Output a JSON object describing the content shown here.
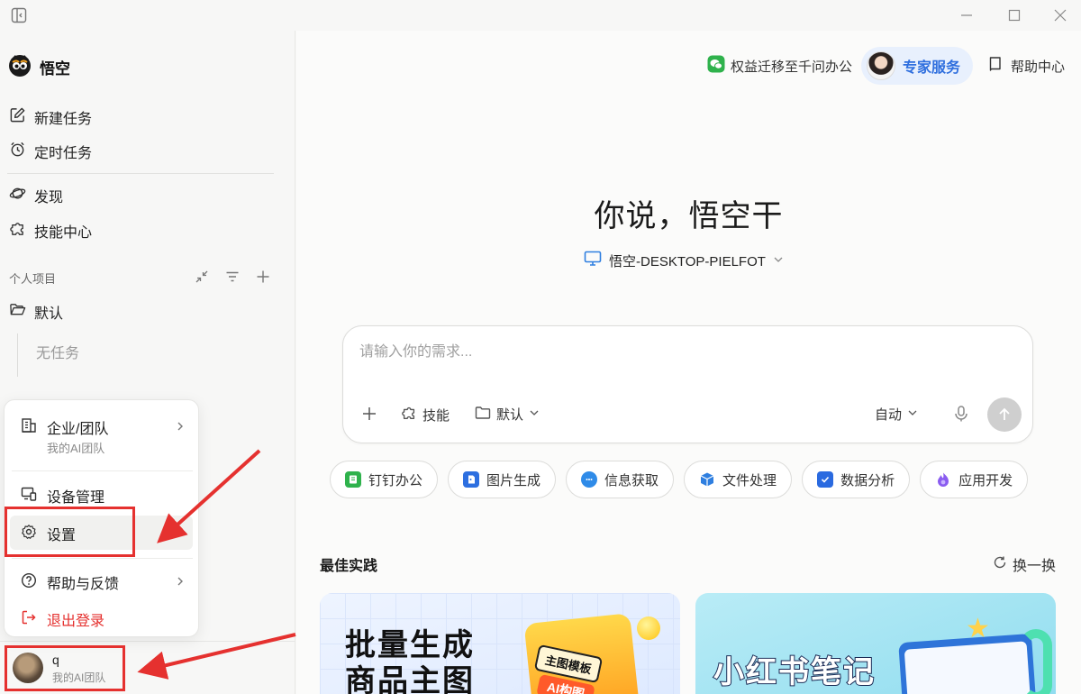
{
  "app": {
    "name": "悟空"
  },
  "sidebar": {
    "nav_top": [
      {
        "label": "新建任务",
        "icon": "edit-icon"
      },
      {
        "label": "定时任务",
        "icon": "alarm-clock-icon"
      }
    ],
    "nav_mid": [
      {
        "label": "发现",
        "icon": "planet-icon"
      },
      {
        "label": "技能中心",
        "icon": "puzzle-icon"
      }
    ],
    "projects": {
      "label": "个人项目",
      "folder": "默认",
      "empty_text": "无任务"
    }
  },
  "popup_menu": {
    "team": {
      "label": "企业/团队",
      "sub": "我的AI团队"
    },
    "device": {
      "label": "设备管理"
    },
    "settings": {
      "label": "设置"
    },
    "help": {
      "label": "帮助与反馈"
    },
    "logout": {
      "label": "退出登录"
    }
  },
  "user": {
    "name": "q",
    "team": "我的AI团队"
  },
  "header": {
    "migrate": "权益迁移至千问办公",
    "expert": "专家服务",
    "help": "帮助中心"
  },
  "hero": {
    "title": "你说，悟空干",
    "device": "悟空-DESKTOP-PIELFOT"
  },
  "input": {
    "placeholder": "请输入你的需求...",
    "skill": "技能",
    "folder": "默认",
    "mode": "自动"
  },
  "chips": [
    {
      "label": "钉钉办公",
      "icon": "dingtalk-icon",
      "color": "#2fb24c"
    },
    {
      "label": "图片生成",
      "icon": "image-doc-icon",
      "color": "#2d6fe0"
    },
    {
      "label": "信息获取",
      "icon": "chat-bubble-icon",
      "color": "#2f8be8"
    },
    {
      "label": "文件处理",
      "icon": "cube-icon",
      "color": "#2f7fe0"
    },
    {
      "label": "数据分析",
      "icon": "checkbox-icon",
      "color": "#2a6ae0"
    },
    {
      "label": "应用开发",
      "icon": "flame-icon",
      "color": "#8a5cf0"
    }
  ],
  "best_practice": {
    "title": "最佳实践",
    "refresh": "换一换",
    "cards": [
      {
        "title_line1": "批量生成",
        "title_line2": "商品主图",
        "tag": "主图模板",
        "tag2": "AI构图"
      },
      {
        "title": "小红书笔记"
      }
    ]
  },
  "colors": {
    "accent": "#2f6fde",
    "danger": "#e5312f"
  }
}
